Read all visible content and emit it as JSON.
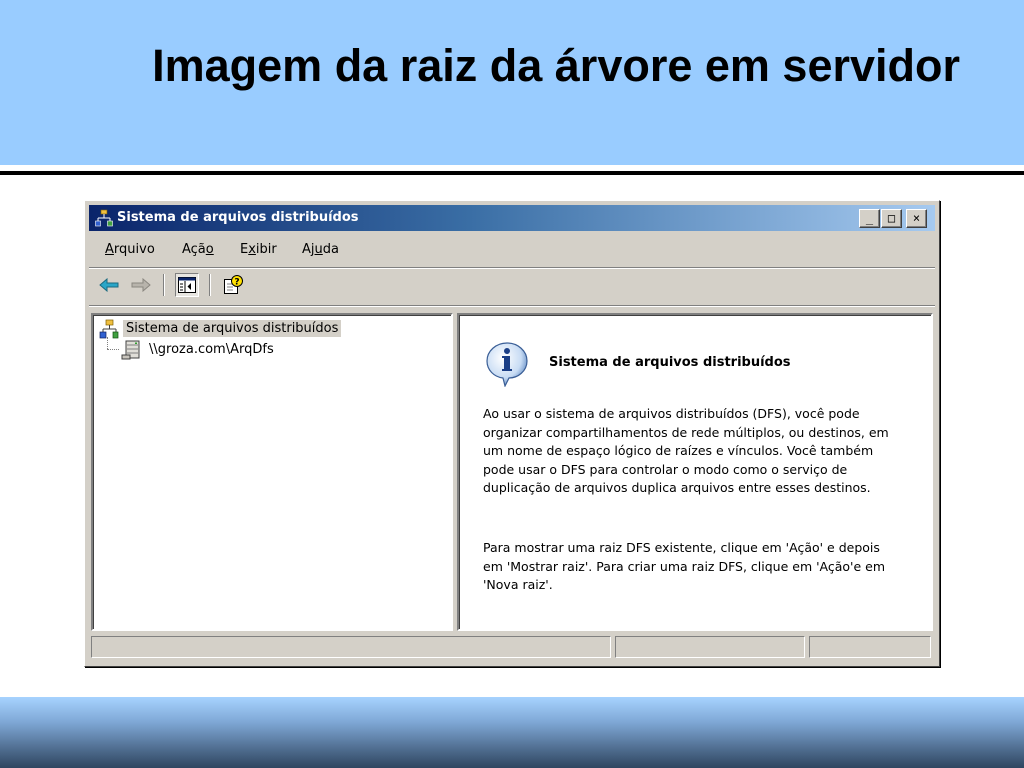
{
  "slide": {
    "title": "Imagem da raiz da árvore em servidor"
  },
  "window": {
    "title": "Sistema de arquivos distribuídos",
    "app_icon": "dfs-icon",
    "controls": {
      "minimize": "_",
      "maximize": "□",
      "close": "×"
    }
  },
  "menu": [
    {
      "label": "Arquivo",
      "accel_pre": "",
      "accel": "A",
      "accel_post": "rquivo"
    },
    {
      "label": "Ação",
      "accel_pre": "Açã",
      "accel": "o",
      "accel_post": ""
    },
    {
      "label": "Exibir",
      "accel_pre": "E",
      "accel": "x",
      "accel_post": "ibir"
    },
    {
      "label": "Ajuda",
      "accel_pre": "Aj",
      "accel": "u",
      "accel_post": "da"
    }
  ],
  "toolbar": {
    "buttons": [
      "back-arrow-icon",
      "forward-arrow-icon",
      "show-hide-tree-icon",
      "help-icon"
    ]
  },
  "tree": {
    "root": {
      "label": "Sistema de arquivos distribuídos",
      "icon": "dfs-icon"
    },
    "child": {
      "label": "\\\\groza.com\\ArqDfs",
      "icon": "server-icon"
    }
  },
  "details": {
    "icon": "info-icon",
    "heading": "Sistema de arquivos distribuídos",
    "paragraph1": "Ao usar o sistema de arquivos distribuídos (DFS), você pode organizar compartilhamentos de rede múltiplos, ou destinos, em um nome de espaço lógico de raízes e vínculos. Você também pode usar o DFS para controlar o modo como o serviço de duplicação de arquivos duplica arquivos entre esses destinos.",
    "paragraph2": "Para mostrar uma raiz DFS existente, clique em 'Ação' e depois em 'Mostrar raiz'. Para criar uma raiz DFS, clique em 'Ação'e em 'Nova raiz'."
  },
  "colors": {
    "slide_header": "#99ccff",
    "titlebar_start": "#0a246a",
    "titlebar_end": "#a6caf0",
    "window_face": "#d4d0c8"
  }
}
